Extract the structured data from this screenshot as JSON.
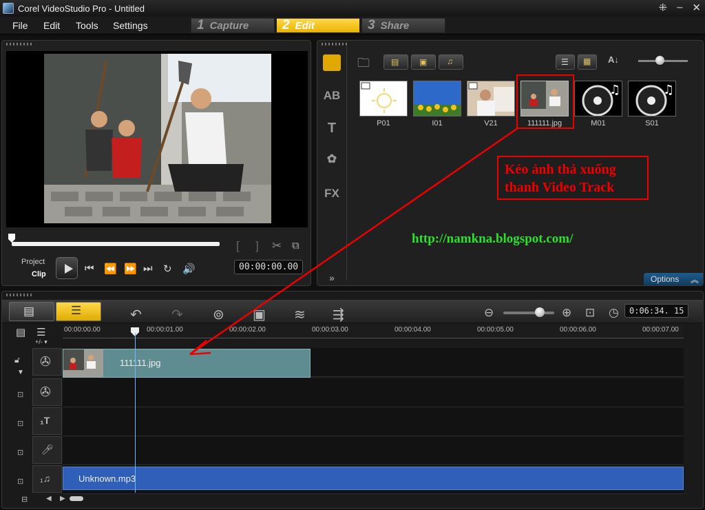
{
  "window": {
    "title": "Corel VideoStudio Pro - Untitled"
  },
  "menu": {
    "items": [
      "File",
      "Edit",
      "Tools",
      "Settings"
    ]
  },
  "steps": [
    {
      "num": "1",
      "label": "Capture",
      "active": false
    },
    {
      "num": "2",
      "label": "Edit",
      "active": true
    },
    {
      "num": "3",
      "label": "Share",
      "active": false
    }
  ],
  "preview": {
    "project_label": "Project",
    "clip_label": "Clip",
    "timecode": "00:00:00.00"
  },
  "library": {
    "thumbnails": [
      {
        "label": "P01",
        "kind": "sun-pattern"
      },
      {
        "label": "I01",
        "kind": "sunflower-field"
      },
      {
        "label": "V21",
        "kind": "video-person"
      },
      {
        "label": "111111.jpg",
        "kind": "photo",
        "selected": true
      },
      {
        "label": "M01",
        "kind": "music-disc"
      },
      {
        "label": "S01",
        "kind": "music-disc"
      }
    ],
    "annotation": {
      "line1": "Kéo ảnh thả xuống",
      "line2": "thanh Video Track"
    },
    "blog_url": "http://namkna.blogspot.com/",
    "options_label": "Options"
  },
  "timeline": {
    "duration": "0:06:34. 15",
    "ruler_labels": [
      "00:00:00.00",
      "00:00:01.00",
      "00:00:02.00",
      "00:00:03.00",
      "00:00:04.00",
      "00:00:05.00",
      "00:00:06.00",
      "00:00:07.00"
    ],
    "video_clip_label": "111111.jpg",
    "audio_clip_label": "Unknown.mp3"
  },
  "colors": {
    "accent": "#f5c518",
    "annotation": "#e00000",
    "url": "#2ee02e",
    "audio_clip": "#2f5fb8",
    "video_clip": "#5f8c91"
  }
}
